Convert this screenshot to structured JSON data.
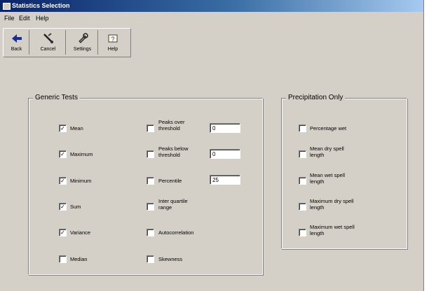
{
  "window": {
    "title": "Statistics Selection"
  },
  "menu": [
    "File",
    "Edit",
    "Help"
  ],
  "toolbar": [
    {
      "label": "Back",
      "icon": "back-arrow-icon"
    },
    {
      "label": "Cancel",
      "icon": "cancel-tool-icon"
    },
    {
      "label": "Settings",
      "icon": "settings-icon"
    },
    {
      "label": "Help",
      "icon": "help-icon"
    }
  ],
  "generic": {
    "title": "Generic Tests",
    "col1": [
      {
        "label": "Mean",
        "checked": true
      },
      {
        "label": "Maximum",
        "checked": true
      },
      {
        "label": "Minimum",
        "checked": true
      },
      {
        "label": "Sum",
        "checked": true
      },
      {
        "label": "Variance",
        "checked": true
      },
      {
        "label": "Median",
        "checked": false
      }
    ],
    "col2": [
      {
        "label": "Peaks over threshold",
        "checked": false,
        "value": "0"
      },
      {
        "label": "Peaks below threshold",
        "checked": false,
        "value": "0"
      },
      {
        "label": "Percentile",
        "checked": false,
        "value": "25"
      },
      {
        "label": "Inter quartile range",
        "checked": false
      },
      {
        "label": "Autocorrelation",
        "checked": false
      },
      {
        "label": "Skewness",
        "checked": false
      }
    ]
  },
  "precip": {
    "title": "Precipitation Only",
    "items": [
      {
        "label": "Percentage wet",
        "checked": false
      },
      {
        "label": "Mean dry spell length",
        "checked": false
      },
      {
        "label": "Mean wet spell length",
        "checked": false
      },
      {
        "label": "Maximum dry spell length",
        "checked": false
      },
      {
        "label": "Maximum wet spell length",
        "checked": false
      }
    ]
  }
}
